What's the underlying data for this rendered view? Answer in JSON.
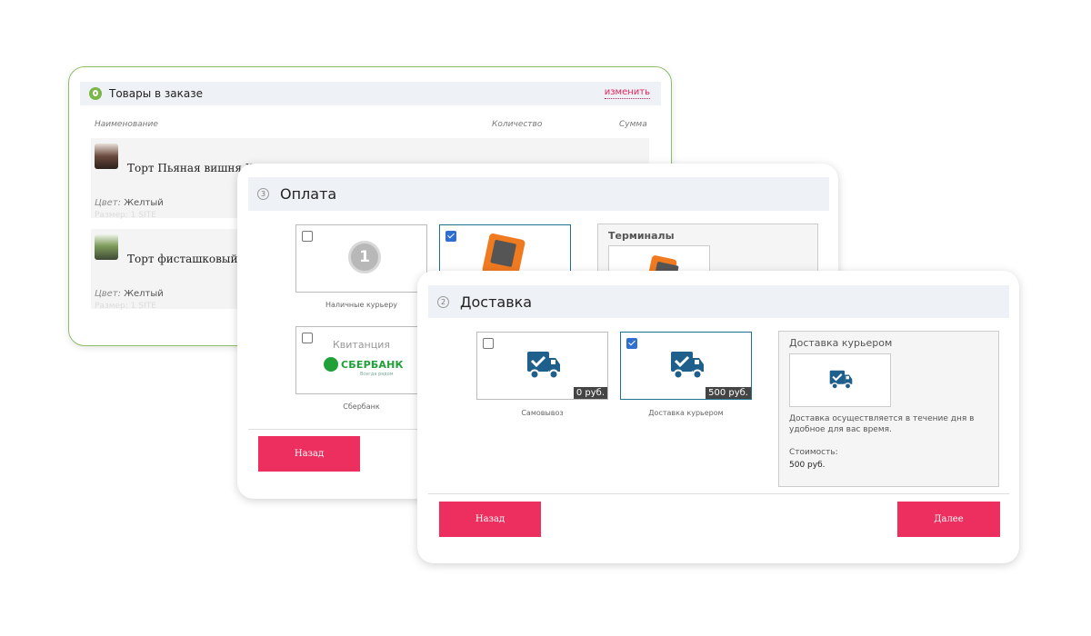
{
  "items": {
    "title": "Товары в заказе",
    "edit_link": "изменить",
    "columns": {
      "name": "Наименование",
      "qty": "Количество",
      "sum": "Сумма"
    },
    "products": [
      {
        "name": "Торт Пьяная вишня Же",
        "attr_key": "Цвет:",
        "attr_val": "Желтый",
        "faded": "Размер: 1 SITE"
      },
      {
        "name": "Торт фисташковый Ж",
        "attr_key": "Цвет:",
        "attr_val": "Желтый",
        "faded": "Размер: 1 SITE"
      }
    ]
  },
  "payment": {
    "step": "3",
    "title": "Оплата",
    "options": [
      {
        "label": "Наличные курьеру",
        "checked": false,
        "icon": "coin-1-icon",
        "icon_text": "1"
      },
      {
        "label": "",
        "checked": true,
        "icon": "payment-terminal-icon"
      },
      {
        "label": "Сбербанк",
        "checked": false,
        "top_text": "Квитанция",
        "brand": "СБЕРБАНК",
        "brand_sub": "Всегда рядом"
      }
    ],
    "info_title": "Терминалы",
    "back_label": "Назад"
  },
  "delivery": {
    "step": "2",
    "title": "Доставка",
    "options": [
      {
        "label": "Самовывоз",
        "price": "0 руб.",
        "checked": false,
        "icon": "delivery-truck-icon"
      },
      {
        "label": "Доставка курьером",
        "price": "500 руб.",
        "checked": true,
        "icon": "delivery-truck-icon"
      }
    ],
    "info": {
      "title": "Доставка курьером",
      "description": "Доставка осуществляется в течение дня в удобное для вас время.",
      "cost_label": "Стоимость:",
      "cost_value": "500 руб."
    },
    "back_label": "Назад",
    "next_label": "Далее"
  },
  "colors": {
    "accent": "#ec2f5f",
    "truck": "#1f5f8b",
    "check": "#2f6fd0",
    "green": "#7ab648"
  }
}
